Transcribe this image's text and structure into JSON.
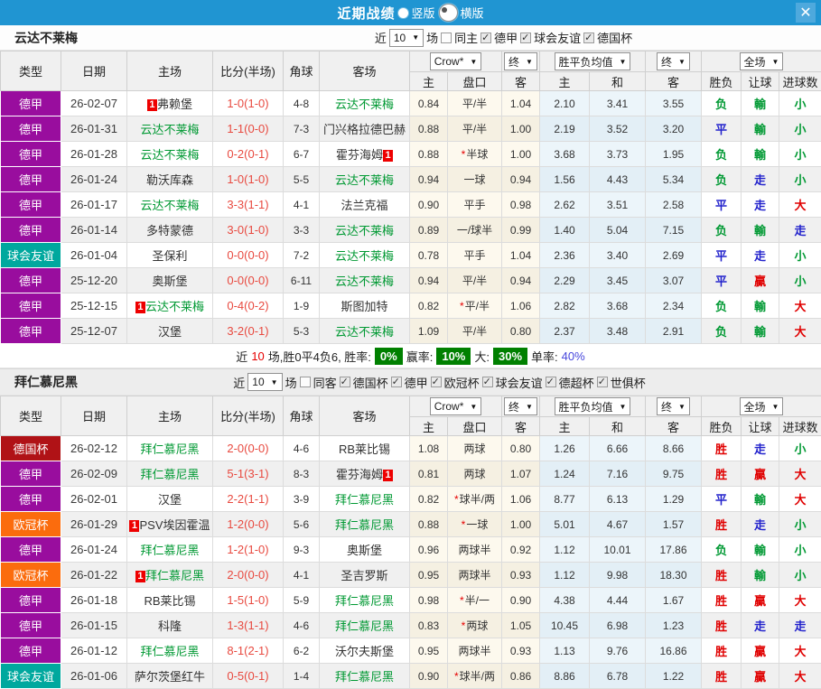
{
  "topbar": {
    "title": "近期战绩",
    "radios": [
      {
        "label": "竖版",
        "selected": false
      },
      {
        "label": "横版",
        "selected": true
      }
    ],
    "close_icon": "✕"
  },
  "table_header": {
    "left_cols": [
      "类型",
      "日期",
      "主场",
      "比分(半场)",
      "角球",
      "客场"
    ],
    "dropdowns": {
      "company": "Crow*",
      "company_time": "终",
      "avg": "胜平负均值",
      "avg_time": "终",
      "period": "全场"
    },
    "sub_cols": [
      "主",
      "盘口",
      "客",
      "主",
      "和",
      "客",
      "胜负",
      "让球",
      "进球数"
    ]
  },
  "league_colors": {
    "德甲": "#990d9e",
    "球会友谊": "#00a89e",
    "德国杯": "#b01216",
    "欧冠杯": "#fb6c0d"
  },
  "result_color_map": {
    "胜": "red",
    "贏": "red",
    "大": "red",
    "平": "blue",
    "走": "blue",
    "负": "green",
    "輸": "green",
    "小": "green"
  },
  "result_colors": {
    "red": "#e00000",
    "blue": "#2222cc",
    "green": "#009933"
  },
  "colors": {
    "topbar": "#2095d2",
    "score": "#e8493f",
    "focus_team": "#009933",
    "red_card_badge": "#ee0000",
    "summary_badge": "#008000"
  },
  "sections": [
    {
      "team": "云达不莱梅",
      "filters": {
        "pre": "近",
        "count": "10",
        "post": "场",
        "venue": {
          "label": "同主",
          "checked": false
        },
        "leagues": [
          {
            "label": "德甲",
            "checked": true
          },
          {
            "label": "球会友谊",
            "checked": true
          },
          {
            "label": "德国杯",
            "checked": true
          }
        ]
      },
      "rows": [
        {
          "league": "德甲",
          "date": "26-02-07",
          "home": {
            "name": "弗赖堡",
            "badge": "before"
          },
          "score": "1-0(1-0)",
          "corners": "4-8",
          "away": {
            "name": "云达不莱梅",
            "focus": true
          },
          "odds": [
            "0.84",
            "平/半",
            "1.04"
          ],
          "star": false,
          "avg": [
            "2.10",
            "3.41",
            "3.55"
          ],
          "res": [
            "负",
            "輸",
            "小"
          ]
        },
        {
          "league": "德甲",
          "date": "26-01-31",
          "home": {
            "name": "云达不莱梅",
            "focus": true
          },
          "score": "1-1(0-0)",
          "corners": "7-3",
          "away": {
            "name": "门兴格拉德巴赫"
          },
          "odds": [
            "0.88",
            "平/半",
            "1.00"
          ],
          "star": false,
          "avg": [
            "2.19",
            "3.52",
            "3.20"
          ],
          "res": [
            "平",
            "輸",
            "小"
          ]
        },
        {
          "league": "德甲",
          "date": "26-01-28",
          "home": {
            "name": "云达不莱梅",
            "focus": true
          },
          "score": "0-2(0-1)",
          "corners": "6-7",
          "away": {
            "name": "霍芬海姆",
            "badge": "after"
          },
          "odds": [
            "0.88",
            "半球",
            "1.00"
          ],
          "star": true,
          "avg": [
            "3.68",
            "3.73",
            "1.95"
          ],
          "res": [
            "负",
            "輸",
            "小"
          ]
        },
        {
          "league": "德甲",
          "date": "26-01-24",
          "home": {
            "name": "勒沃库森"
          },
          "score": "1-0(1-0)",
          "corners": "5-5",
          "away": {
            "name": "云达不莱梅",
            "focus": true
          },
          "odds": [
            "0.94",
            "一球",
            "0.94"
          ],
          "star": false,
          "avg": [
            "1.56",
            "4.43",
            "5.34"
          ],
          "res": [
            "负",
            "走",
            "小"
          ]
        },
        {
          "league": "德甲",
          "date": "26-01-17",
          "home": {
            "name": "云达不莱梅",
            "focus": true
          },
          "score": "3-3(1-1)",
          "corners": "4-1",
          "away": {
            "name": "法兰克福"
          },
          "odds": [
            "0.90",
            "平手",
            "0.98"
          ],
          "star": false,
          "avg": [
            "2.62",
            "3.51",
            "2.58"
          ],
          "res": [
            "平",
            "走",
            "大"
          ]
        },
        {
          "league": "德甲",
          "date": "26-01-14",
          "home": {
            "name": "多特蒙德"
          },
          "score": "3-0(1-0)",
          "corners": "3-3",
          "away": {
            "name": "云达不莱梅",
            "focus": true
          },
          "odds": [
            "0.89",
            "一/球半",
            "0.99"
          ],
          "star": false,
          "avg": [
            "1.40",
            "5.04",
            "7.15"
          ],
          "res": [
            "负",
            "輸",
            "走"
          ]
        },
        {
          "league": "球会友谊",
          "date": "26-01-04",
          "home": {
            "name": "圣保利"
          },
          "score": "0-0(0-0)",
          "corners": "7-2",
          "away": {
            "name": "云达不莱梅",
            "focus": true
          },
          "odds": [
            "0.78",
            "平手",
            "1.04"
          ],
          "star": false,
          "avg": [
            "2.36",
            "3.40",
            "2.69"
          ],
          "res": [
            "平",
            "走",
            "小"
          ]
        },
        {
          "league": "德甲",
          "date": "25-12-20",
          "home": {
            "name": "奥斯堡"
          },
          "score": "0-0(0-0)",
          "corners": "6-11",
          "away": {
            "name": "云达不莱梅",
            "focus": true
          },
          "odds": [
            "0.94",
            "平/半",
            "0.94"
          ],
          "star": false,
          "avg": [
            "2.29",
            "3.45",
            "3.07"
          ],
          "res": [
            "平",
            "贏",
            "小"
          ]
        },
        {
          "league": "德甲",
          "date": "25-12-15",
          "home": {
            "name": "云达不莱梅",
            "focus": true,
            "badge": "before"
          },
          "score": "0-4(0-2)",
          "corners": "1-9",
          "away": {
            "name": "斯图加特"
          },
          "odds": [
            "0.82",
            "平/半",
            "1.06"
          ],
          "star": true,
          "avg": [
            "2.82",
            "3.68",
            "2.34"
          ],
          "res": [
            "负",
            "輸",
            "大"
          ]
        },
        {
          "league": "德甲",
          "date": "25-12-07",
          "home": {
            "name": "汉堡"
          },
          "score": "3-2(0-1)",
          "corners": "5-3",
          "away": {
            "name": "云达不莱梅",
            "focus": true
          },
          "odds": [
            "1.09",
            "平/半",
            "0.80"
          ],
          "star": false,
          "avg": [
            "2.37",
            "3.48",
            "2.91"
          ],
          "res": [
            "负",
            "輸",
            "大"
          ]
        }
      ],
      "summary": [
        {
          "t": "近"
        },
        {
          "t": "10",
          "style": "red"
        },
        {
          "t": "场,胜0平4负6, 胜率:"
        },
        {
          "t": "0%",
          "style": "badge"
        },
        {
          "t": "赢率:"
        },
        {
          "t": "10%",
          "style": "badge"
        },
        {
          "t": "大:"
        },
        {
          "t": "30%",
          "style": "badge"
        },
        {
          "t": "单率:"
        },
        {
          "t": "40%",
          "style": "blue"
        }
      ]
    },
    {
      "team": "拜仁慕尼黑",
      "filters": {
        "pre": "近",
        "count": "10",
        "post": "场",
        "venue": {
          "label": "同客",
          "checked": false
        },
        "leagues": [
          {
            "label": "德国杯",
            "checked": true
          },
          {
            "label": "德甲",
            "checked": true
          },
          {
            "label": "欧冠杯",
            "checked": true
          },
          {
            "label": "球会友谊",
            "checked": true
          },
          {
            "label": "德超杯",
            "checked": true
          },
          {
            "label": "世俱杯",
            "checked": true
          }
        ]
      },
      "rows": [
        {
          "league": "德国杯",
          "date": "26-02-12",
          "home": {
            "name": "拜仁慕尼黑",
            "focus": true
          },
          "score": "2-0(0-0)",
          "corners": "4-6",
          "away": {
            "name": "RB莱比锡"
          },
          "odds": [
            "1.08",
            "两球",
            "0.80"
          ],
          "star": false,
          "avg": [
            "1.26",
            "6.66",
            "8.66"
          ],
          "res": [
            "胜",
            "走",
            "小"
          ]
        },
        {
          "league": "德甲",
          "date": "26-02-09",
          "home": {
            "name": "拜仁慕尼黑",
            "focus": true
          },
          "score": "5-1(3-1)",
          "corners": "8-3",
          "away": {
            "name": "霍芬海姆",
            "badge": "after"
          },
          "odds": [
            "0.81",
            "两球",
            "1.07"
          ],
          "star": false,
          "avg": [
            "1.24",
            "7.16",
            "9.75"
          ],
          "res": [
            "胜",
            "贏",
            "大"
          ]
        },
        {
          "league": "德甲",
          "date": "26-02-01",
          "home": {
            "name": "汉堡"
          },
          "score": "2-2(1-1)",
          "corners": "3-9",
          "away": {
            "name": "拜仁慕尼黑",
            "focus": true
          },
          "odds": [
            "0.82",
            "球半/两",
            "1.06"
          ],
          "star": true,
          "avg": [
            "8.77",
            "6.13",
            "1.29"
          ],
          "res": [
            "平",
            "輸",
            "大"
          ]
        },
        {
          "league": "欧冠杯",
          "date": "26-01-29",
          "home": {
            "name": "PSV埃因霍温",
            "badge": "before"
          },
          "score": "1-2(0-0)",
          "corners": "5-6",
          "away": {
            "name": "拜仁慕尼黑",
            "focus": true
          },
          "odds": [
            "0.88",
            "一球",
            "1.00"
          ],
          "star": true,
          "avg": [
            "5.01",
            "4.67",
            "1.57"
          ],
          "res": [
            "胜",
            "走",
            "小"
          ]
        },
        {
          "league": "德甲",
          "date": "26-01-24",
          "home": {
            "name": "拜仁慕尼黑",
            "focus": true
          },
          "score": "1-2(1-0)",
          "corners": "9-3",
          "away": {
            "name": "奥斯堡"
          },
          "odds": [
            "0.96",
            "两球半",
            "0.92"
          ],
          "star": false,
          "avg": [
            "1.12",
            "10.01",
            "17.86"
          ],
          "res": [
            "负",
            "輸",
            "小"
          ]
        },
        {
          "league": "欧冠杯",
          "date": "26-01-22",
          "home": {
            "name": "拜仁慕尼黑",
            "focus": true,
            "badge": "before"
          },
          "score": "2-0(0-0)",
          "corners": "4-1",
          "away": {
            "name": "圣吉罗斯"
          },
          "odds": [
            "0.95",
            "两球半",
            "0.93"
          ],
          "star": false,
          "avg": [
            "1.12",
            "9.98",
            "18.30"
          ],
          "res": [
            "胜",
            "輸",
            "小"
          ]
        },
        {
          "league": "德甲",
          "date": "26-01-18",
          "home": {
            "name": "RB莱比锡"
          },
          "score": "1-5(1-0)",
          "corners": "5-9",
          "away": {
            "name": "拜仁慕尼黑",
            "focus": true
          },
          "odds": [
            "0.98",
            "半/一",
            "0.90"
          ],
          "star": true,
          "avg": [
            "4.38",
            "4.44",
            "1.67"
          ],
          "res": [
            "胜",
            "贏",
            "大"
          ]
        },
        {
          "league": "德甲",
          "date": "26-01-15",
          "home": {
            "name": "科隆"
          },
          "score": "1-3(1-1)",
          "corners": "4-6",
          "away": {
            "name": "拜仁慕尼黑",
            "focus": true
          },
          "odds": [
            "0.83",
            "两球",
            "1.05"
          ],
          "star": true,
          "avg": [
            "10.45",
            "6.98",
            "1.23"
          ],
          "res": [
            "胜",
            "走",
            "走"
          ]
        },
        {
          "league": "德甲",
          "date": "26-01-12",
          "home": {
            "name": "拜仁慕尼黑",
            "focus": true
          },
          "score": "8-1(2-1)",
          "corners": "6-2",
          "away": {
            "name": "沃尔夫斯堡"
          },
          "odds": [
            "0.95",
            "两球半",
            "0.93"
          ],
          "star": false,
          "avg": [
            "1.13",
            "9.76",
            "16.86"
          ],
          "res": [
            "胜",
            "贏",
            "大"
          ]
        },
        {
          "league": "球会友谊",
          "date": "26-01-06",
          "home": {
            "name": "萨尔茨堡红牛"
          },
          "score": "0-5(0-1)",
          "corners": "1-4",
          "away": {
            "name": "拜仁慕尼黑",
            "focus": true
          },
          "odds": [
            "0.90",
            "球半/两",
            "0.86"
          ],
          "star": true,
          "avg": [
            "8.86",
            "6.78",
            "1.22"
          ],
          "res": [
            "胜",
            "贏",
            "大"
          ]
        }
      ],
      "summary": null
    }
  ]
}
